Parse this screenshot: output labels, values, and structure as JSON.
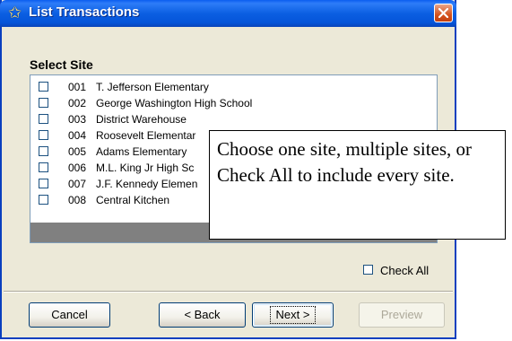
{
  "window": {
    "title": "List Transactions",
    "title_icon": "star-icon",
    "close_icon": "close-icon"
  },
  "section": {
    "label": "Select Site"
  },
  "sites": [
    {
      "code": "001",
      "name": "T. Jefferson Elementary",
      "checked": false
    },
    {
      "code": "002",
      "name": "George Washington High School",
      "checked": false
    },
    {
      "code": "003",
      "name": "District Warehouse",
      "checked": false
    },
    {
      "code": "004",
      "name": "Roosevelt Elementar",
      "checked": false
    },
    {
      "code": "005",
      "name": "Adams Elementary",
      "checked": false
    },
    {
      "code": "006",
      "name": "M.L. King Jr High Sc",
      "checked": false
    },
    {
      "code": "007",
      "name": "J.F. Kennedy Elemen",
      "checked": false
    },
    {
      "code": "008",
      "name": "Central Kitchen",
      "checked": false
    }
  ],
  "check_all": {
    "label": "Check All",
    "checked": false
  },
  "buttons": {
    "cancel": "Cancel",
    "back": "< Back",
    "next": "Next >",
    "preview": "Preview"
  },
  "callout": {
    "text": "Choose one site, multiple sites, or Check All to include every site."
  },
  "colors": {
    "title_bar": "#0a5ef0",
    "window_face": "#ece9d8",
    "close_button": "#d4531f",
    "list_empty_area": "#808080"
  }
}
